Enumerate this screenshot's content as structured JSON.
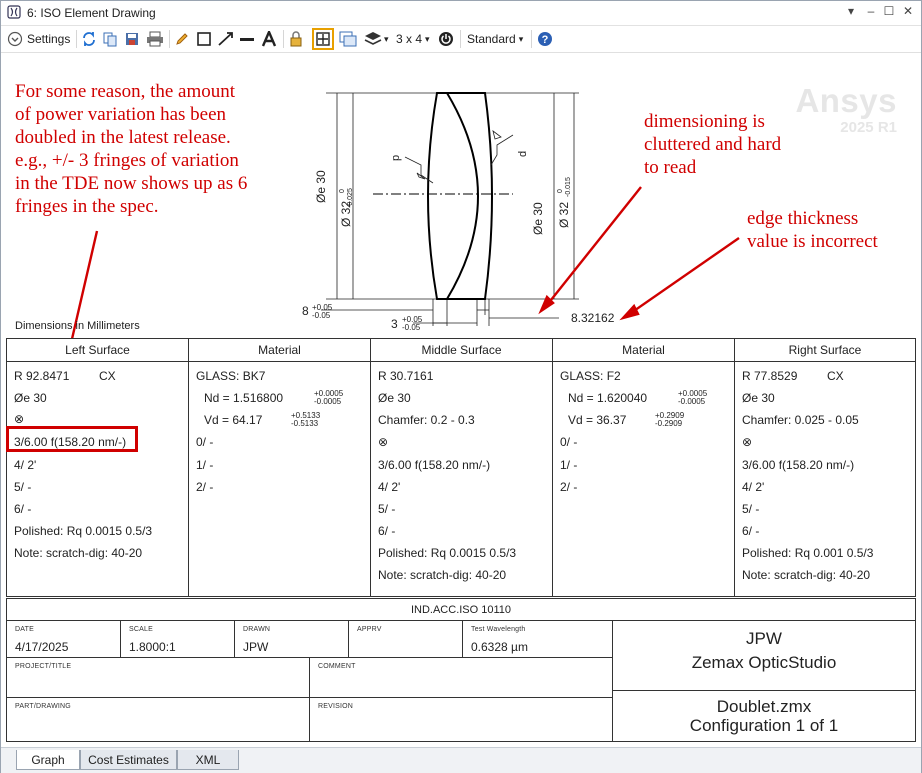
{
  "window": {
    "title": "6: ISO Element Drawing",
    "controls": [
      "▾",
      "–",
      "☐",
      "✕"
    ]
  },
  "toolbar": {
    "settings_label": "Settings",
    "layout_label": "3 x 4",
    "style_label": "Standard"
  },
  "annotations": {
    "power_note": [
      "For some reason, the amount",
      "of power variation has been",
      "doubled in the latest release.",
      "e.g., +/- 3 fringes of variation",
      "in the TDE now shows up as 6",
      "fringes in the spec."
    ],
    "dimension_note": [
      "dimensioning is",
      "cluttered and hard",
      "to read"
    ],
    "edge_note": [
      "edge thickness",
      "value is incorrect"
    ],
    "color": "#d00000"
  },
  "watermark": {
    "brand": "Ansys",
    "version": "2025 R1"
  },
  "drawing": {
    "left_d": "Øe 30",
    "left_D": "Ø 32",
    "left_D_tol_upper": "0",
    "left_D_tol_lower": "-0.025",
    "right_d": "Øe 30",
    "right_D": "Ø 32",
    "right_D_tol_upper": "0",
    "right_D_tol_lower": "-0.015",
    "p_label": "p",
    "d_label": "d",
    "thk1": "8",
    "thk1_tol_upper": "+0.05",
    "thk1_tol_lower": "-0.05",
    "thk2": "3",
    "thk2_tol_upper": "+0.05",
    "thk2_tol_lower": "-0.05",
    "edge_thickness": "8.32162",
    "units_caption": "Dimensions in Millimeters"
  },
  "spec_table": {
    "headers": [
      "Left Surface",
      "Material",
      "Middle Surface",
      "Material",
      "Right Surface"
    ],
    "left": {
      "radius": "R 92.8471",
      "form": "CX",
      "diameter": "Øe 30",
      "coating_symbol": "⊗",
      "lines": [
        "3/6.00 f(158.20 nm/-)",
        "4/ 2'",
        "5/ -",
        "6/ -",
        "Polished: Rq 0.0015 0.5/3",
        "Note: scratch-dig: 40-20"
      ]
    },
    "material1": {
      "glass": "GLASS: BK7",
      "nd": "Nd = 1.516800",
      "nd_tol_upper": "+0.0005",
      "nd_tol_lower": "-0.0005",
      "vd": "Vd = 64.17",
      "vd_tol_upper": "+0.5133",
      "vd_tol_lower": "-0.5133",
      "lines": [
        "0/ -",
        "1/ -",
        "2/ -"
      ]
    },
    "middle": {
      "radius": "R 30.7161",
      "diameter": "Øe 30",
      "chamfer": "Chamfer: 0.2 - 0.3",
      "coating_symbol": "⊗",
      "lines": [
        "3/6.00 f(158.20 nm/-)",
        "4/ 2'",
        "5/ -",
        "6/ -",
        "Polished: Rq 0.0015 0.5/3",
        "Note: scratch-dig: 40-20"
      ]
    },
    "material2": {
      "glass": "GLASS: F2",
      "nd": "Nd = 1.620040",
      "nd_tol_upper": "+0.0005",
      "nd_tol_lower": "-0.0005",
      "vd": "Vd = 36.37",
      "vd_tol_upper": "+0.2909",
      "vd_tol_lower": "-0.2909",
      "lines": [
        "0/ -",
        "1/ -",
        "2/ -"
      ]
    },
    "right": {
      "radius": "R 77.8529",
      "form": "CX",
      "diameter": "Øe 30",
      "chamfer": "Chamfer: 0.025 - 0.05",
      "coating_symbol": "⊗",
      "lines": [
        "3/6.00 f(158.20 nm/-)",
        "4/ 2'",
        "5/ -",
        "6/ -",
        "Polished: Rq 0.001 0.5/3",
        "Note: scratch-dig: 40-20"
      ]
    }
  },
  "title_block": {
    "standard": "IND.ACC.ISO 10110",
    "date_label": "DATE",
    "date": "4/17/2025",
    "scale_label": "SCALE",
    "scale": "1.8000:1",
    "drawn_label": "DRAWN",
    "drawn": "JPW",
    "apprv_label": "APPRV",
    "apprv": "",
    "wavelength_label": "Test Wavelength",
    "wavelength": "0.6328 µm",
    "project_label": "PROJECT/TITLE",
    "comment_label": "COMMENT",
    "part_label": "PART/DRAWING",
    "revision_label": "REVISION",
    "author": "JPW",
    "software": "Zemax OpticStudio",
    "file": "Doublet.zmx",
    "config": "Configuration 1 of 1"
  },
  "tabs": [
    "Graph",
    "Cost Estimates",
    "XML"
  ]
}
